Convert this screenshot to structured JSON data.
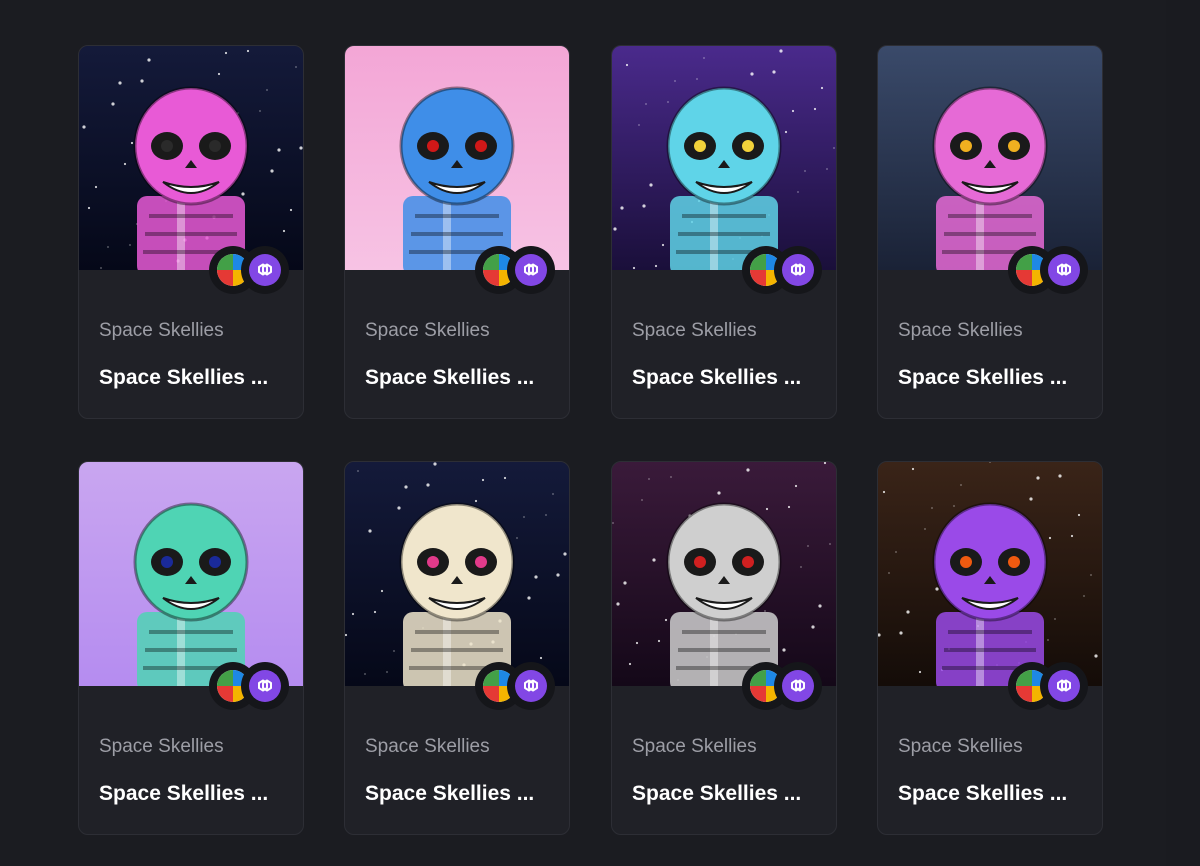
{
  "cards": [
    {
      "collection": "Space Skellies",
      "name": "Space Skellies ...",
      "bg": "#141a3a",
      "bg2": "#050818",
      "skin": "#e85ad6",
      "eye": "#2a2a2a",
      "style": "space"
    },
    {
      "collection": "Space Skellies",
      "name": "Space Skellies ...",
      "bg": "#f3a6d6",
      "bg2": "#f7c3e4",
      "skin": "#3f8ee8",
      "eye": "#d01818",
      "style": "pink"
    },
    {
      "collection": "Space Skellies",
      "name": "Space Skellies ...",
      "bg": "#4a2a8c",
      "bg2": "#1a0f3a",
      "skin": "#5fd4e8",
      "eye": "#f2d23a",
      "style": "galaxy"
    },
    {
      "collection": "Space Skellies",
      "name": "Space Skellies ...",
      "bg": "#3a4a6a",
      "bg2": "#1a2236",
      "skin": "#e66ad6",
      "eye": "#f0b020",
      "style": "ship"
    },
    {
      "collection": "Space Skellies",
      "name": "Space Skellies ...",
      "bg": "#c9a6f0",
      "bg2": "#b58cf0",
      "skin": "#4fd4b4",
      "eye": "#1a2a9a",
      "style": "lilac"
    },
    {
      "collection": "Space Skellies",
      "name": "Space Skellies ...",
      "bg": "#141a3a",
      "bg2": "#050818",
      "skin": "#f0e6cc",
      "eye": "#e23a8a",
      "style": "space"
    },
    {
      "collection": "Space Skellies",
      "name": "Space Skellies ...",
      "bg": "#3a1a3a",
      "bg2": "#140818",
      "skin": "#cfcfcf",
      "eye": "#d02020",
      "style": "fire"
    },
    {
      "collection": "Space Skellies",
      "name": "Space Skellies ...",
      "bg": "#3a2418",
      "bg2": "#140c08",
      "skin": "#9a4ae8",
      "eye": "#f05a10",
      "style": "nebula"
    }
  ],
  "badges": {
    "chain_a_icon": "multicolor-chain-icon",
    "chain_b_icon": "polygon-icon"
  },
  "colors": {
    "polygon": "#8247e5",
    "card_bg": "#202127",
    "page_bg": "#1b1c21"
  }
}
